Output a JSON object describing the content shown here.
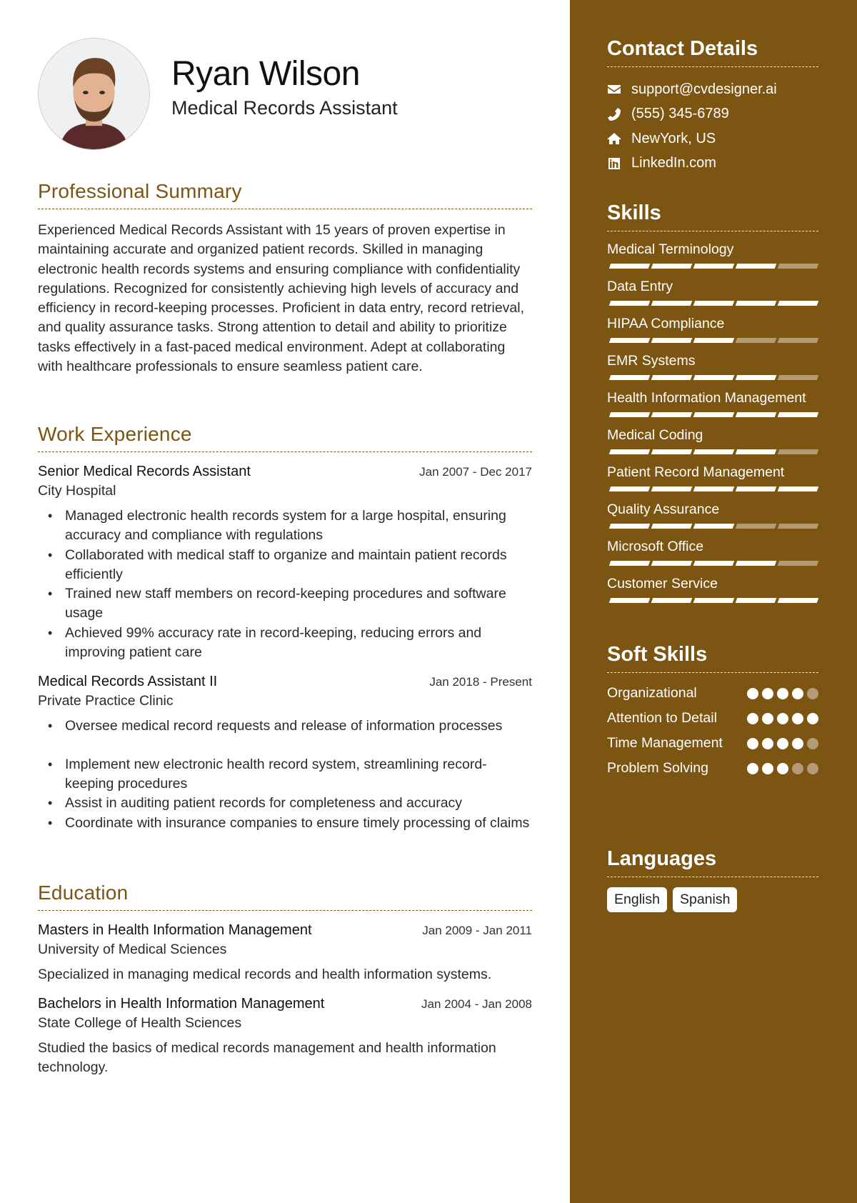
{
  "header": {
    "name": "Ryan Wilson",
    "title": "Medical Records Assistant",
    "photo_alt": "profile-photo"
  },
  "summary": {
    "heading": "Professional Summary",
    "text": "Experienced Medical Records Assistant with 15 years of proven expertise in maintaining accurate and organized patient records. Skilled in managing electronic health records systems and ensuring compliance with confidentiality regulations. Recognized for consistently achieving high levels of accuracy and efficiency in record-keeping processes. Proficient in data entry, record retrieval, and quality assurance tasks. Strong attention to detail and ability to prioritize tasks effectively in a fast-paced medical environment. Adept at collaborating with healthcare professionals to ensure seamless patient care."
  },
  "work": {
    "heading": "Work Experience",
    "jobs": [
      {
        "title": "Senior Medical Records Assistant",
        "dates": "Jan 2007 - Dec 2017",
        "org": "City Hospital",
        "bullets": [
          "Managed electronic health records system for a large hospital, ensuring accuracy and compliance with regulations",
          "Collaborated with medical staff to organize and maintain patient records efficiently",
          "Trained new staff members on record-keeping procedures and software usage",
          "Achieved 99% accuracy rate in record-keeping, reducing errors and improving patient care"
        ]
      },
      {
        "title": "Medical Records Assistant II",
        "dates": "Jan 2018 - Present",
        "org": "Private Practice Clinic",
        "bullets": [
          "Oversee medical record requests and release of information processes",
          "Implement new electronic health record system, streamlining record-keeping procedures",
          "Assist in auditing patient records for completeness and accuracy",
          "Coordinate with insurance companies to ensure timely processing of claims"
        ]
      }
    ]
  },
  "education": {
    "heading": "Education",
    "items": [
      {
        "degree": "Masters in Health Information Management",
        "dates": "Jan 2009 - Jan 2011",
        "school": "University of Medical Sciences",
        "desc": "Specialized in managing medical records and health information systems."
      },
      {
        "degree": "Bachelors in Health Information Management",
        "dates": "Jan 2004 - Jan 2008",
        "school": "State College of Health Sciences",
        "desc": "Studied the basics of medical records management and health information technology."
      }
    ]
  },
  "contact": {
    "heading": "Contact Details",
    "items": [
      {
        "icon": "envelope-icon",
        "text": "support@cvdesigner.ai"
      },
      {
        "icon": "phone-icon",
        "text": "(555) 345-6789"
      },
      {
        "icon": "home-icon",
        "text": "NewYork, US"
      },
      {
        "icon": "linkedin-icon",
        "text": "LinkedIn.com"
      }
    ]
  },
  "skills": {
    "heading": "Skills",
    "max": 5,
    "items": [
      {
        "name": "Medical Terminology",
        "level": 4
      },
      {
        "name": "Data Entry",
        "level": 5
      },
      {
        "name": "HIPAA Compliance",
        "level": 3
      },
      {
        "name": "EMR Systems",
        "level": 4
      },
      {
        "name": "Health Information Management",
        "level": 5
      },
      {
        "name": "Medical Coding",
        "level": 4
      },
      {
        "name": "Patient Record Management",
        "level": 5
      },
      {
        "name": "Quality Assurance",
        "level": 3
      },
      {
        "name": "Microsoft Office",
        "level": 4
      },
      {
        "name": "Customer Service",
        "level": 5
      }
    ]
  },
  "soft_skills": {
    "heading": "Soft Skills",
    "max": 5,
    "items": [
      {
        "name": "Organizational",
        "level": 4
      },
      {
        "name": "Attention to Detail",
        "level": 5
      },
      {
        "name": "Time Management",
        "level": 4
      },
      {
        "name": "Problem Solving",
        "level": 3
      }
    ]
  },
  "languages": {
    "heading": "Languages",
    "items": [
      "English",
      "Spanish"
    ]
  },
  "colors": {
    "accent": "#7d5512",
    "sidebar_bg": "#7d5512",
    "rating_on": "#ffffff",
    "rating_off": "#b39b76"
  }
}
